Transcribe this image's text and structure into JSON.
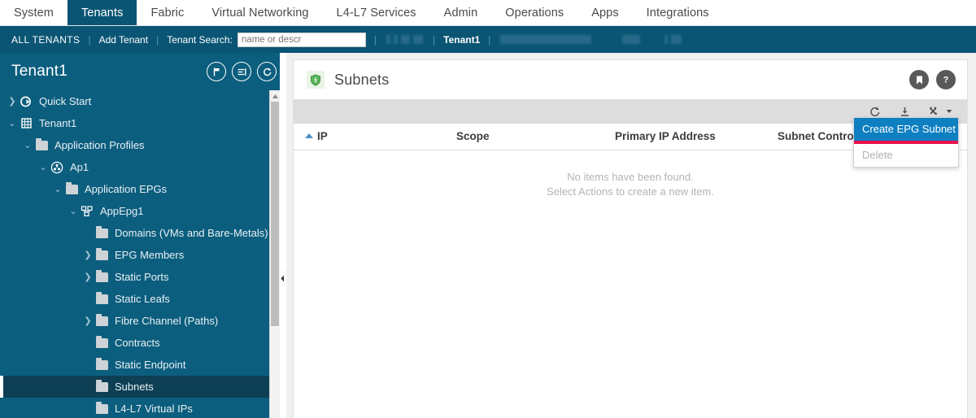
{
  "topnav": {
    "tabs": [
      {
        "label": "System",
        "active": false
      },
      {
        "label": "Tenants",
        "active": true
      },
      {
        "label": "Fabric",
        "active": false
      },
      {
        "label": "Virtual Networking",
        "active": false
      },
      {
        "label": "L4-L7 Services",
        "active": false
      },
      {
        "label": "Admin",
        "active": false
      },
      {
        "label": "Operations",
        "active": false
      },
      {
        "label": "Apps",
        "active": false
      },
      {
        "label": "Integrations",
        "active": false
      }
    ]
  },
  "subnav": {
    "all_tenants": "ALL TENANTS",
    "add_tenant": "Add Tenant",
    "search_label": "Tenant Search:",
    "search_placeholder": "name or descr",
    "search_value": "",
    "current_tenant": "Tenant1",
    "separator": "|"
  },
  "sidebar": {
    "title": "Tenant1",
    "header_icons": [
      {
        "name": "flag-icon"
      },
      {
        "name": "list-view-icon"
      },
      {
        "name": "refresh-icon"
      }
    ],
    "tree": [
      {
        "label": "Quick Start",
        "indent": 0,
        "chevron": "right",
        "icon": "quickstart-icon",
        "selected": false
      },
      {
        "label": "Tenant1",
        "indent": 0,
        "chevron": "down",
        "icon": "tenant-icon",
        "selected": false
      },
      {
        "label": "Application Profiles",
        "indent": 1,
        "chevron": "down",
        "icon": "folder-icon",
        "selected": false
      },
      {
        "label": "Ap1",
        "indent": 2,
        "chevron": "down",
        "icon": "appprofile-icon",
        "selected": false
      },
      {
        "label": "Application EPGs",
        "indent": 3,
        "chevron": "down",
        "icon": "folder-icon",
        "selected": false
      },
      {
        "label": "AppEpg1",
        "indent": 4,
        "chevron": "down",
        "icon": "epg-icon",
        "selected": false
      },
      {
        "label": "Domains (VMs and Bare-Metals)",
        "indent": 5,
        "chevron": "none",
        "icon": "folder-icon",
        "selected": false
      },
      {
        "label": "EPG Members",
        "indent": 5,
        "chevron": "right",
        "icon": "folder-icon",
        "selected": false
      },
      {
        "label": "Static Ports",
        "indent": 5,
        "chevron": "right",
        "icon": "folder-icon",
        "selected": false
      },
      {
        "label": "Static Leafs",
        "indent": 5,
        "chevron": "none",
        "icon": "folder-icon",
        "selected": false
      },
      {
        "label": "Fibre Channel (Paths)",
        "indent": 5,
        "chevron": "right",
        "icon": "folder-icon",
        "selected": false
      },
      {
        "label": "Contracts",
        "indent": 5,
        "chevron": "none",
        "icon": "folder-icon",
        "selected": false
      },
      {
        "label": "Static Endpoint",
        "indent": 5,
        "chevron": "none",
        "icon": "folder-icon",
        "selected": false
      },
      {
        "label": "Subnets",
        "indent": 5,
        "chevron": "none",
        "icon": "folder-icon",
        "selected": true
      },
      {
        "label": "L4-L7 Virtual IPs",
        "indent": 5,
        "chevron": "none",
        "icon": "folder-icon",
        "selected": false
      }
    ]
  },
  "panel": {
    "title": "Subnets",
    "status_icon": "shield-green-icon",
    "head_icons": [
      {
        "name": "bookmark-icon"
      },
      {
        "name": "help-icon"
      }
    ],
    "toolbar_icons": [
      {
        "name": "refresh-icon"
      },
      {
        "name": "download-icon"
      },
      {
        "name": "actions-tools-icon"
      }
    ],
    "columns": [
      "IP",
      "Scope",
      "Primary IP Address",
      "Subnet Control"
    ],
    "sorted_column": "IP",
    "sort_direction": "asc",
    "rows": [],
    "empty_line1": "No items have been found.",
    "empty_line2": "Select Actions to create a new item."
  },
  "dropdown": {
    "items": [
      {
        "label": "Create EPG Subnet",
        "state": "highlight"
      },
      {
        "label": "Delete",
        "state": "disabled"
      }
    ]
  },
  "colors": {
    "nav_teal": "#0a5574",
    "sidebar_teal": "#0c5e7e",
    "sidebar_selected": "#0d4055",
    "menu_highlight": "#0e7fc1",
    "annotation_red": "#e8114b",
    "shield_green": "#4caf50",
    "sort_arrow_blue": "#4a90c4"
  }
}
